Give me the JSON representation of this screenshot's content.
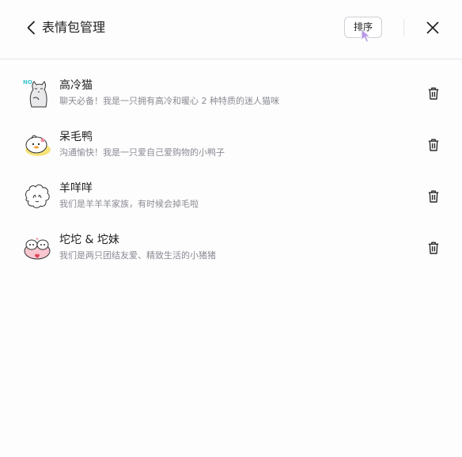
{
  "header": {
    "title": "表情包管理",
    "sort_label": "排序"
  },
  "packs": [
    {
      "name": "高冷猫",
      "description": "聊天必备！我是一只拥有高冷和暖心 2 种特质的迷人猫咪",
      "sticker_icon": "cool-cat-sticker-icon"
    },
    {
      "name": "呆毛鸭",
      "description": "沟通愉快！我是一只爱自己爱购物的小鸭子",
      "sticker_icon": "duck-sticker-icon"
    },
    {
      "name": "羊咩咩",
      "description": "我们是羊羊羊家族，有时候会掉毛啦",
      "sticker_icon": "sheep-sticker-icon"
    },
    {
      "name": "坨坨 & 坨妹",
      "description": "我们是两只团结友爱、精致生活的小猪猪",
      "sticker_icon": "pig-sticker-icon"
    }
  ],
  "colors": {
    "divider": "#e6e6ea",
    "secondary_text": "#8a8b92",
    "cursor": "#b99ae6"
  }
}
